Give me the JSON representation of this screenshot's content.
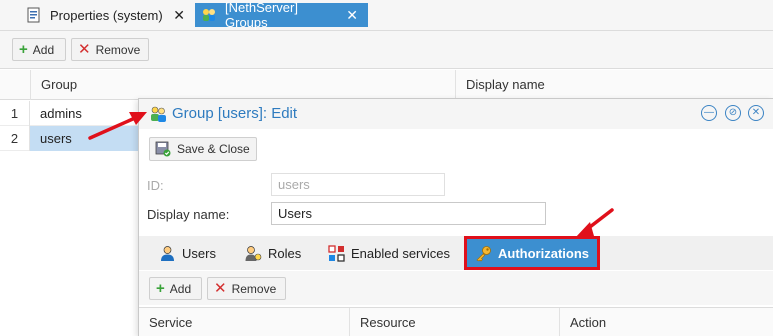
{
  "tabs": [
    {
      "label": "Properties (system)",
      "close": "✕",
      "icon": "properties-icon",
      "active": false
    },
    {
      "label": "[NethServer] Groups",
      "close": "✕",
      "icon": "groups-icon",
      "active": true
    }
  ],
  "toolbar": {
    "add_label": "Add",
    "remove_label": "Remove"
  },
  "grid": {
    "columns": [
      "Group",
      "Display name"
    ],
    "rows": [
      {
        "num": "1",
        "name": "admins",
        "selected": false
      },
      {
        "num": "2",
        "name": "users",
        "selected": true
      }
    ]
  },
  "dialog": {
    "title": "Group [users]: Edit",
    "save_label": "Save & Close",
    "id_label": "ID:",
    "id_value": "users",
    "display_name_label": "Display name:",
    "display_name_value": "Users",
    "subtabs": [
      "Users",
      "Roles",
      "Enabled services",
      "Authorizations"
    ],
    "active_subtab": "Authorizations",
    "sub_toolbar": {
      "add_label": "Add",
      "remove_label": "Remove"
    },
    "sub_columns": [
      "Service",
      "Resource",
      "Action"
    ]
  },
  "colors": {
    "accent": "#3c8fd0",
    "highlight": "#e0101b",
    "selected_row": "#c4ddf3"
  }
}
